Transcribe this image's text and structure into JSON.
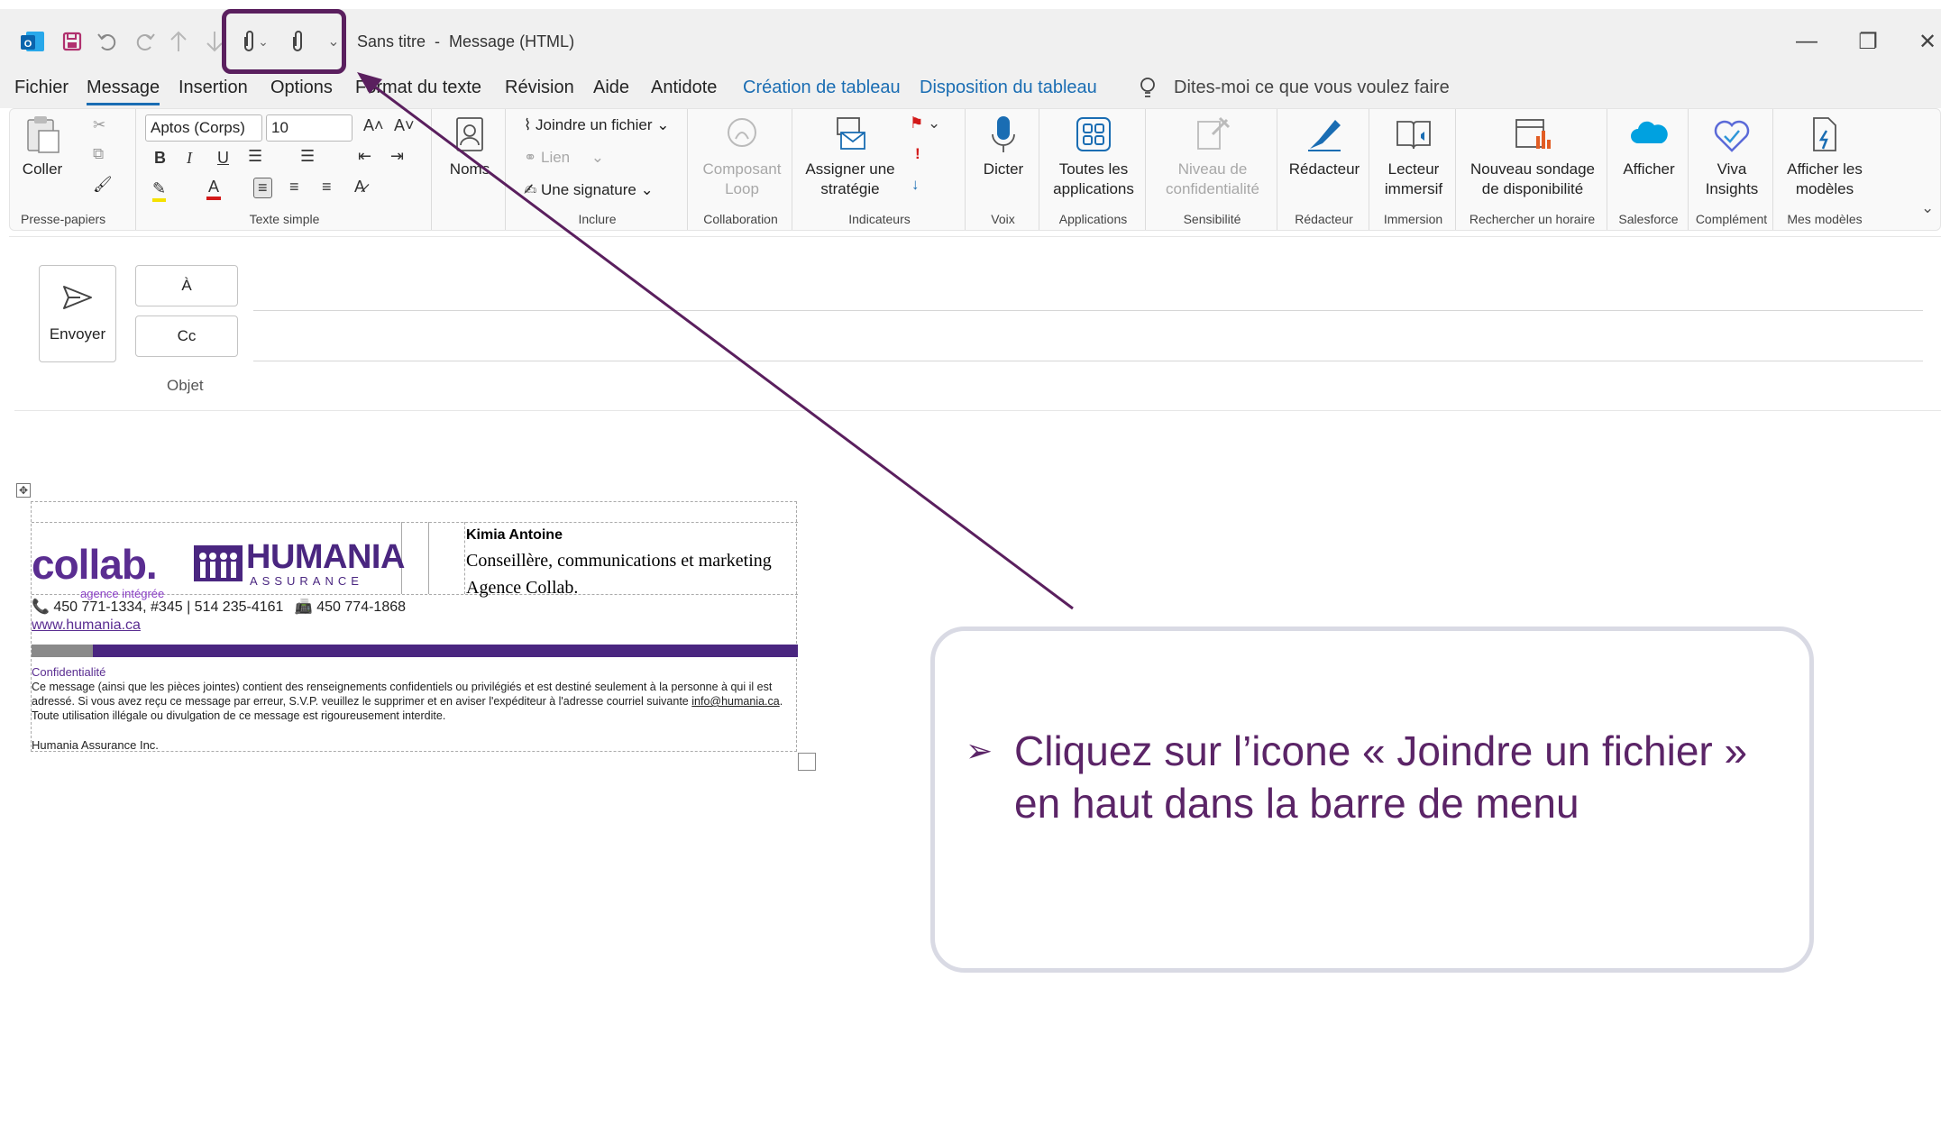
{
  "titlebar": {
    "title": "Sans titre  -  Message (HTML)",
    "icons": [
      "outlook-logo",
      "save-icon",
      "undo-icon",
      "redo-icon",
      "up-arrow-icon",
      "down-arrow-icon",
      "attach-icon",
      "chevron-down-icon",
      "attach-icon",
      "customize-icon"
    ],
    "minimize": "—",
    "restore": "❐",
    "close": "✕"
  },
  "tabs": [
    {
      "label": "Fichier"
    },
    {
      "label": "Message"
    },
    {
      "label": "Insertion"
    },
    {
      "label": "Options"
    },
    {
      "label": "Format du texte"
    },
    {
      "label": "Révision"
    },
    {
      "label": "Aide"
    },
    {
      "label": "Antidote"
    },
    {
      "label": "Création de tableau"
    },
    {
      "label": "Disposition du tableau"
    }
  ],
  "tellme": "Dites-moi ce que vous voulez faire",
  "ribbon": {
    "clipboard": {
      "paste": "Coller",
      "group": "Presse-papiers"
    },
    "text": {
      "font": "Aptos (Corps)",
      "size": "10",
      "bold": "B",
      "italic": "I",
      "underline": "U",
      "grow": "A^",
      "shrink": "Aˇ",
      "color": "A",
      "group": "Texte simple"
    },
    "names": {
      "label": "Noms"
    },
    "include": {
      "attach": "Joindre un fichier",
      "link": "Lien",
      "signature": "Une signature",
      "group": "Inclure"
    },
    "collab": {
      "label": "Composant Loop",
      "group": "Collaboration"
    },
    "tags": {
      "label": "Assigner une stratégie",
      "group": "Indicateurs"
    },
    "voice": {
      "label": "Dicter",
      "group": "Voix"
    },
    "apps": {
      "label": "Toutes les applications",
      "group": "Applications"
    },
    "sensitivity": {
      "label": "Niveau de confidentialité",
      "group": "Sensibilité"
    },
    "editor": {
      "label": "Rédacteur",
      "group": "Rédacteur"
    },
    "immersive": {
      "label": "Lecteur immersif",
      "group": "Immersion"
    },
    "poll": {
      "label": "Nouveau sondage de disponibilité",
      "group": "Rechercher un horaire"
    },
    "salesforce": {
      "label": "Afficher",
      "group": "Salesforce"
    },
    "viva": {
      "label": "Viva Insights",
      "group": "Complément"
    },
    "templates": {
      "label": "Afficher les modèles",
      "group": "Mes modèles"
    }
  },
  "compose": {
    "send": "Envoyer",
    "to": "À",
    "cc": "Cc",
    "subject": "Objet"
  },
  "signature": {
    "collab_logo": "collab.",
    "collab_sub": "agence intégrée",
    "humania_logo": "HUMANIA",
    "humania_sub": "ASSURANCE",
    "name": "Kimia Antoine",
    "role": "Conseillère, communications et marketing Agence Collab.",
    "phones": "450 771-1334, #345  |  514 235-4161",
    "fax": "450 774-1868",
    "url": "www.humania.ca",
    "conf_title": "Confidentialité",
    "conf_text": "Ce message (ainsi que les pièces jointes) contient des renseignements confidentiels ou privilégiés et est destiné seulement à la personne à qui il est adressé. Si vous avez reçu ce message par erreur, S.V.P. veuillez le supprimer et en aviser l'expéditeur à l'adresse courriel suivante",
    "conf_email": "info@humania.ca",
    "conf_tail": ". Toute utilisation illégale ou divulgation de ce message est rigoureusement interdite.",
    "company": "Humania Assurance Inc."
  },
  "callout": {
    "bullet": "➢",
    "text": "Cliquez sur l’icone « Joindre un fichier » en haut dans la barre de menu"
  },
  "colors": {
    "accent": "#1a6db3",
    "annotation": "#5a1f5e",
    "humania": "#5a2d91"
  }
}
